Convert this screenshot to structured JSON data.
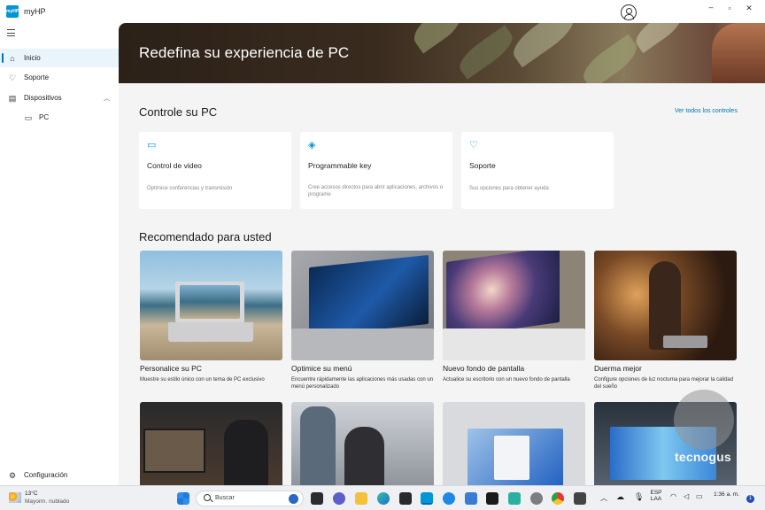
{
  "app": {
    "title": "myHP",
    "logo_text": "myHP"
  },
  "sidebar": {
    "items": [
      {
        "label": "Inicio",
        "icon": "home-icon",
        "active": true
      },
      {
        "label": "Soporte",
        "icon": "support-icon",
        "active": false
      },
      {
        "label": "Dispositivos",
        "icon": "devices-icon",
        "active": false
      },
      {
        "label": "PC",
        "icon": "laptop-icon",
        "active": false
      }
    ],
    "settings_label": "Configuración"
  },
  "hero": {
    "title": "Redefina su experiencia de PC"
  },
  "controls": {
    "title": "Controle su PC",
    "link": "Ver todos los controles",
    "cards": [
      {
        "title": "Control de video",
        "desc": "Optimice conferencias y transmisión",
        "icon": "camera-icon"
      },
      {
        "title": "Programmable key",
        "desc": "Cree accesos directos para abrir aplicaciones, archivos o programe",
        "icon": "key-icon"
      },
      {
        "title": "Soporte",
        "desc": "Sus opciones para obtener ayuda",
        "icon": "support-icon"
      }
    ]
  },
  "recommended": {
    "title": "Recomendado para usted",
    "items": [
      {
        "title": "Personalice su PC",
        "desc": "Muestre su estilo único con un tema de PC exclusivo"
      },
      {
        "title": "Optimice su menú",
        "desc": "Encuentre rápidamente las aplicaciones más usadas con un menú personalizado"
      },
      {
        "title": "Nuevo fondo de pantalla",
        "desc": "Actualice su escritorio con un nuevo fondo de pantalla"
      },
      {
        "title": "Duerma mejor",
        "desc": "Configure opciones de luz nocturna para mejorar la calidad del sueño"
      }
    ]
  },
  "taskbar": {
    "weather_temp": "13°C",
    "weather_desc": "Mayorm. nublado",
    "search_placeholder": "Buscar",
    "lang": "ESP",
    "lang_sub": "LAA",
    "time": "1:36 a. m.",
    "notification_count": "1"
  },
  "watermark": {
    "text": "tecnogus"
  },
  "colors": {
    "accent": "#0073b7",
    "hp_blue": "#0096d6",
    "hero_bg": "#2b2118",
    "main_bg": "#f4f4f5"
  }
}
